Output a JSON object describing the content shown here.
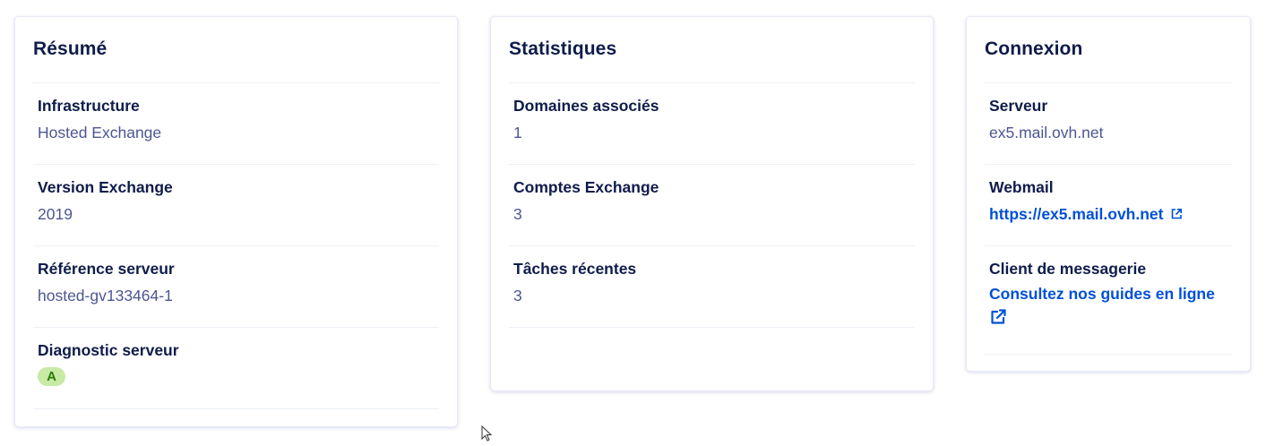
{
  "summary": {
    "title": "Résumé",
    "rows": [
      {
        "label": "Infrastructure",
        "value": "Hosted Exchange"
      },
      {
        "label": "Version Exchange",
        "value": "2019"
      },
      {
        "label": "Référence serveur",
        "value": "hosted-gv133464-1"
      },
      {
        "label": "Diagnostic serveur",
        "value": "A"
      }
    ]
  },
  "statistics": {
    "title": "Statistiques",
    "rows": [
      {
        "label": "Domaines associés",
        "value": "1"
      },
      {
        "label": "Comptes Exchange",
        "value": "3"
      },
      {
        "label": "Tâches récentes",
        "value": "3"
      }
    ]
  },
  "connection": {
    "title": "Connexion",
    "rows": [
      {
        "label": "Serveur",
        "value": "ex5.mail.ovh.net"
      },
      {
        "label": "Webmail",
        "value": "https://ex5.mail.ovh.net",
        "icon": "external-link-icon"
      },
      {
        "label": "Client de messagerie",
        "value": "Consultez nos guides en ligne",
        "icon": "external-link-icon"
      }
    ]
  },
  "colors": {
    "heading": "#0f1c4a",
    "value_text": "#4d5693",
    "link": "#0050d7",
    "badge_bg": "#c7eaa5",
    "badge_text": "#2b7a0b",
    "divider": "#edf0f7"
  }
}
